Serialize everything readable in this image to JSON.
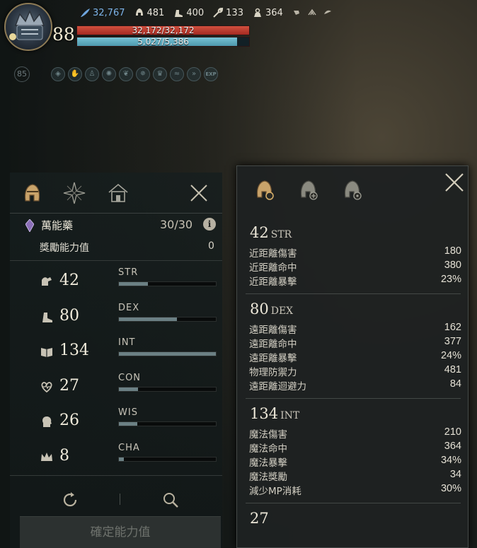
{
  "hud": {
    "level": "88",
    "resources": [
      {
        "icon": "feather-icon",
        "value": "32,767",
        "color": "#7cb3e8"
      },
      {
        "icon": "helmet-icon",
        "value": "481"
      },
      {
        "icon": "boot-icon",
        "value": "400"
      },
      {
        "icon": "wrench-icon",
        "value": "133"
      },
      {
        "icon": "weight-icon",
        "value": "364"
      }
    ],
    "hp": "32,172/32,172",
    "mp": "5,027/5,386",
    "mp_ratio": 0.93,
    "sub_level": "85",
    "exp_badge": "EXP"
  },
  "left": {
    "potion_name": "萬能藥",
    "potion_count": "30/30",
    "info_glyph": "i",
    "bonus_label": "獎勵能力值",
    "bonus_value": "0",
    "stats": [
      {
        "abbr": "STR",
        "value": "42",
        "fill": 0.3,
        "icon": "arm-icon"
      },
      {
        "abbr": "DEX",
        "value": "80",
        "fill": 0.6,
        "icon": "boot-icon"
      },
      {
        "abbr": "INT",
        "value": "134",
        "fill": 1.0,
        "icon": "book-icon"
      },
      {
        "abbr": "CON",
        "value": "27",
        "fill": 0.2,
        "icon": "heart-icon"
      },
      {
        "abbr": "WIS",
        "value": "26",
        "fill": 0.19,
        "icon": "head-icon"
      },
      {
        "abbr": "CHA",
        "value": "8",
        "fill": 0.05,
        "icon": "crown-icon"
      }
    ],
    "confirm_label": "確定能力值"
  },
  "right": {
    "sections": [
      {
        "num": "42",
        "abbr": "STR",
        "rows": [
          {
            "k": "近距離傷害",
            "v": "180"
          },
          {
            "k": "近距離命中",
            "v": "380"
          },
          {
            "k": "近距離暴擊",
            "v": "23%"
          }
        ]
      },
      {
        "num": "80",
        "abbr": "DEX",
        "rows": [
          {
            "k": "遠距離傷害",
            "v": "162"
          },
          {
            "k": "遠距離命中",
            "v": "377"
          },
          {
            "k": "遠距離暴擊",
            "v": "24%"
          },
          {
            "k": "物理防禦力",
            "v": "481"
          },
          {
            "k": "遠距離迴避力",
            "v": "84"
          }
        ]
      },
      {
        "num": "134",
        "abbr": "INT",
        "rows": [
          {
            "k": "魔法傷害",
            "v": "210"
          },
          {
            "k": "魔法命中",
            "v": "364"
          },
          {
            "k": "魔法暴擊",
            "v": "34%"
          },
          {
            "k": "魔法獎勵",
            "v": "34"
          },
          {
            "k": "減少MP消耗",
            "v": "30%"
          }
        ]
      },
      {
        "num": "27",
        "abbr": "",
        "rows": []
      }
    ]
  }
}
